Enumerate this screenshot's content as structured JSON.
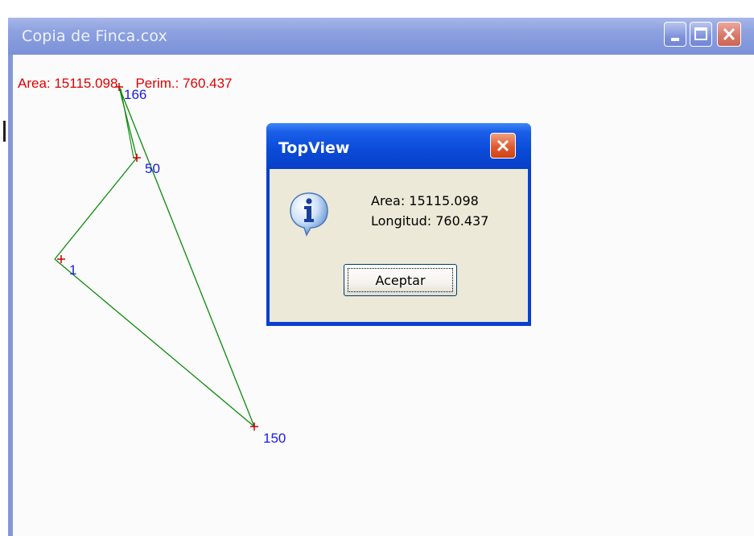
{
  "main_window": {
    "title": "Copia de Finca.cox",
    "controls": {
      "minimize": "minimize-icon",
      "maximize": "maximize-icon",
      "close": "close-icon"
    }
  },
  "plot": {
    "stats": {
      "area": "Area: 15115.098",
      "perimeter": "Perim.: 760.437"
    },
    "points": [
      {
        "label": "166"
      },
      {
        "label": "50"
      },
      {
        "label": "1"
      },
      {
        "label": "150"
      }
    ],
    "colors": {
      "polygon_line": "#0a8a0a",
      "point_marker": "#cc0000",
      "point_label": "#1a1aee",
      "stats_text": "#e00000"
    }
  },
  "dialog": {
    "title": "TopView",
    "icon": "information-icon",
    "message_area": "Area: 15115.098",
    "message_length": "Longitud: 760.437",
    "ok_label": "Aceptar",
    "close": "close-icon"
  }
}
